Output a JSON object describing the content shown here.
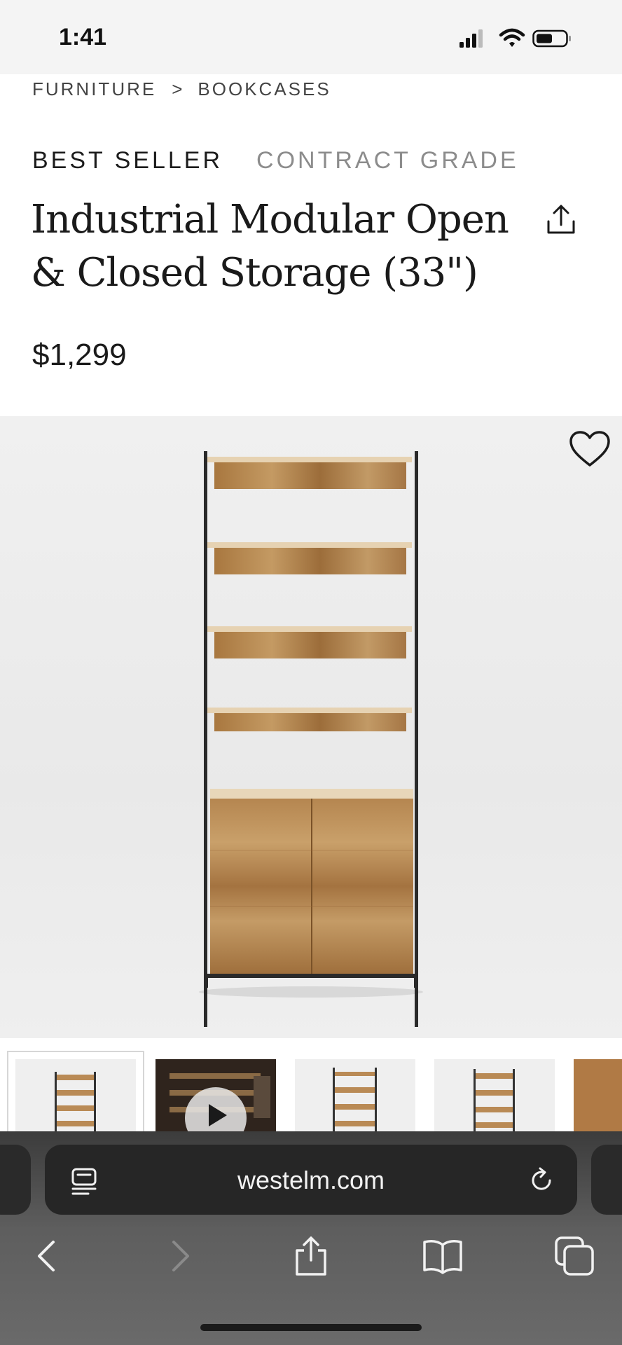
{
  "status_bar": {
    "time": "1:41"
  },
  "breadcrumb": {
    "items": [
      "FURNITURE",
      "BOOKCASES"
    ],
    "separator": ">"
  },
  "badges": {
    "best_seller": "BEST SELLER",
    "contract_grade": "CONTRACT GRADE"
  },
  "product": {
    "title_line1": "Industrial Modular Open",
    "title_line2": "& Closed Storage (33\")",
    "price": "$1,299"
  },
  "browser": {
    "url": "westelm.com"
  },
  "icons": {
    "share": "share-icon",
    "heart": "heart-icon",
    "reader": "reader-icon",
    "reload": "reload-icon",
    "back": "chevron-left-icon",
    "forward": "chevron-right-icon",
    "bookmarks": "book-icon",
    "tabs": "tabs-icon",
    "play": "play-icon"
  },
  "colors": {
    "muted_badge": "#8c8c8c",
    "wood": "#b08250",
    "metal": "#2a2a2a"
  }
}
